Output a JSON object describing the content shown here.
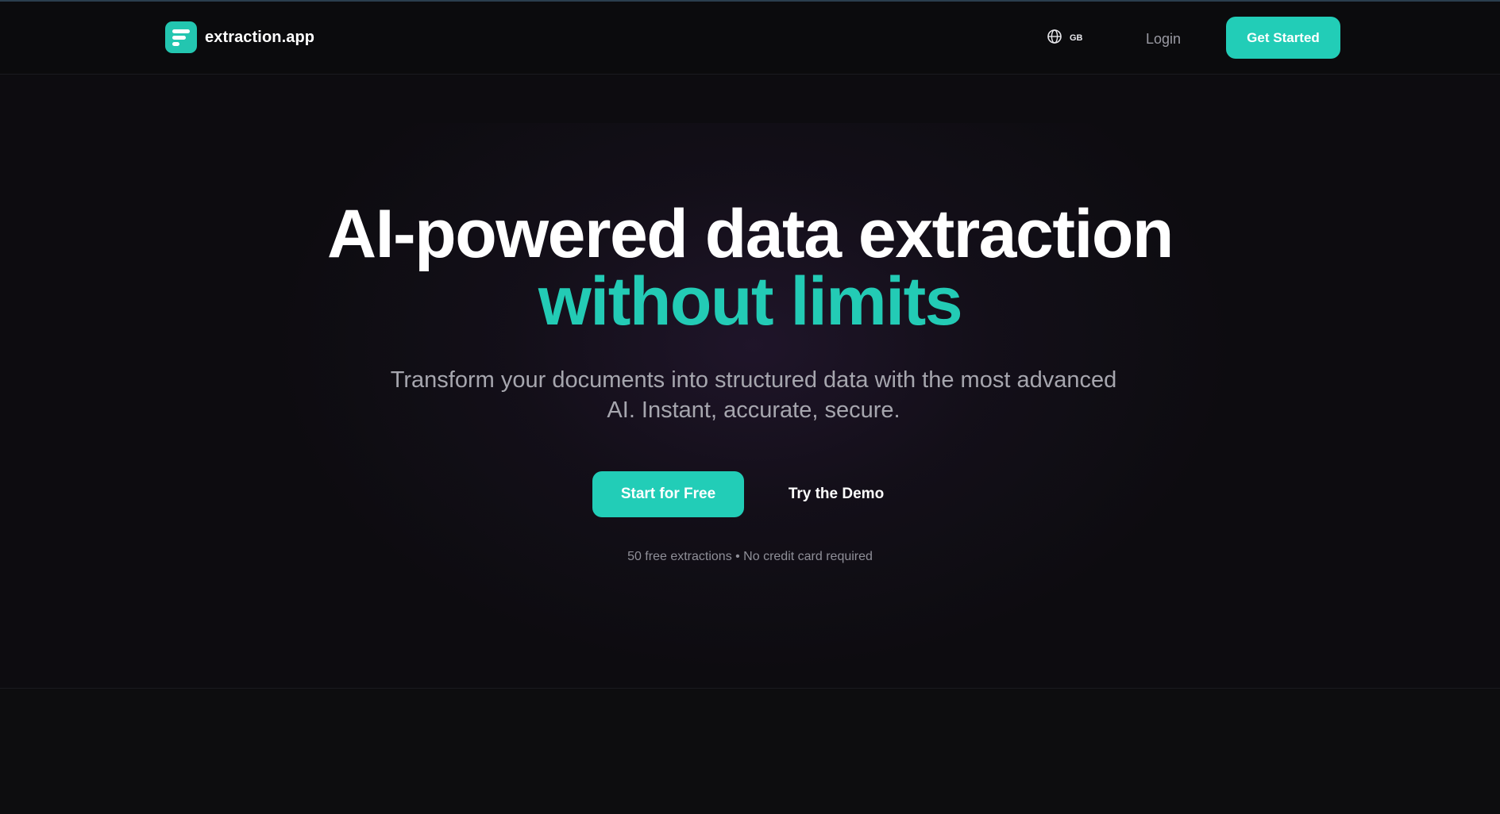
{
  "header": {
    "logo_text": "extraction.app",
    "logo_icon": "document-lines-icon",
    "language_icon": "globe-icon",
    "language_code": "GB",
    "login_label": "Login",
    "cta_label": "Get Started"
  },
  "hero": {
    "headline": "AI-powered data extraction",
    "headline_accent": "without limits",
    "subtitle": "Transform your documents into structured data with the most advanced AI. Instant, accurate, secure.",
    "primary_cta": "Start for Free",
    "secondary_cta": "Try the Demo",
    "note": "50 free extractions • No credit card required"
  },
  "colors": {
    "accent": "#22cdb7",
    "background": "#0c0c0e",
    "text_muted": "#a6a6ae"
  }
}
